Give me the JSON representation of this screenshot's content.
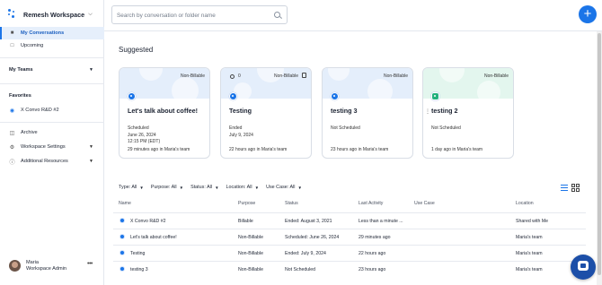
{
  "sidebar": {
    "workspace_name": "Remesh Workspace",
    "items": [
      {
        "label": "My Conversations",
        "icon": "chat-icon"
      },
      {
        "label": "Upcoming",
        "icon": "calendar-icon"
      }
    ],
    "my_teams_label": "My Teams",
    "favorites_label": "Favorites",
    "favorite_items": [
      {
        "label": "X Convo R&D #2"
      }
    ],
    "bottom_items": [
      {
        "label": "Archive",
        "icon": "folder-icon"
      },
      {
        "label": "Workspace Settings",
        "icon": "gear-icon"
      },
      {
        "label": "Additional Resources",
        "icon": "help-icon"
      }
    ],
    "user": {
      "name": "Maria",
      "role": "Workspace Admin"
    }
  },
  "search": {
    "placeholder": "Search by conversation or folder name"
  },
  "colors": {
    "accent": "#1b75e8",
    "active_bg": "#e6effb",
    "chat_fab": "#1c4fa8"
  },
  "suggested": {
    "title": "Suggested",
    "cards": [
      {
        "title": "Let's talk about coffee!",
        "badge": "Non-Billable",
        "status": "Scheduled",
        "date": "June 26, 2024",
        "time": "12:15 PM (EDT)",
        "footer": "29 minutes ago in Maria's team"
      },
      {
        "title": "Testing",
        "badge": "Non-Billable",
        "count": "0",
        "status": "Ended",
        "date": "July 9, 2024",
        "time": "",
        "footer": "22 hours ago in Maria's team"
      },
      {
        "title": "testing 3",
        "badge": "Non-Billable",
        "status": "Not Scheduled",
        "date": "",
        "time": "",
        "footer": "23 hours ago in Maria's team"
      },
      {
        "title": "testing 2",
        "badge": "Non-Billable",
        "status": "Not Scheduled",
        "date": "",
        "time": "",
        "footer": "1 day ago in Maria's team"
      }
    ]
  },
  "filters": [
    {
      "label": "Type: All"
    },
    {
      "label": "Purpose: All"
    },
    {
      "label": "Status: All"
    },
    {
      "label": "Location: All"
    },
    {
      "label": "Use Case: All"
    }
  ],
  "table": {
    "headers": [
      "Name",
      "Purpose",
      "Status",
      "Last Activity",
      "Use Case",
      "Location"
    ],
    "rows": [
      {
        "name": "X Convo R&D #2",
        "purpose": "Billable",
        "status": "Ended: August 3, 2021",
        "activity": "Less than a minute ...",
        "use_case": "",
        "location": "Shared with Me"
      },
      {
        "name": "Let's talk about coffee!",
        "purpose": "Non-Billable",
        "status": "Scheduled: June 26, 2024",
        "activity": "29 minutes ago",
        "use_case": "",
        "location": "Maria's team"
      },
      {
        "name": "Testing",
        "purpose": "Non-Billable",
        "status": "Ended: July 9, 2024",
        "activity": "22 hours ago",
        "use_case": "",
        "location": "Maria's team"
      },
      {
        "name": "testing 3",
        "purpose": "Non-Billable",
        "status": "Not Scheduled",
        "activity": "23 hours ago",
        "use_case": "",
        "location": "Maria's team"
      }
    ]
  }
}
